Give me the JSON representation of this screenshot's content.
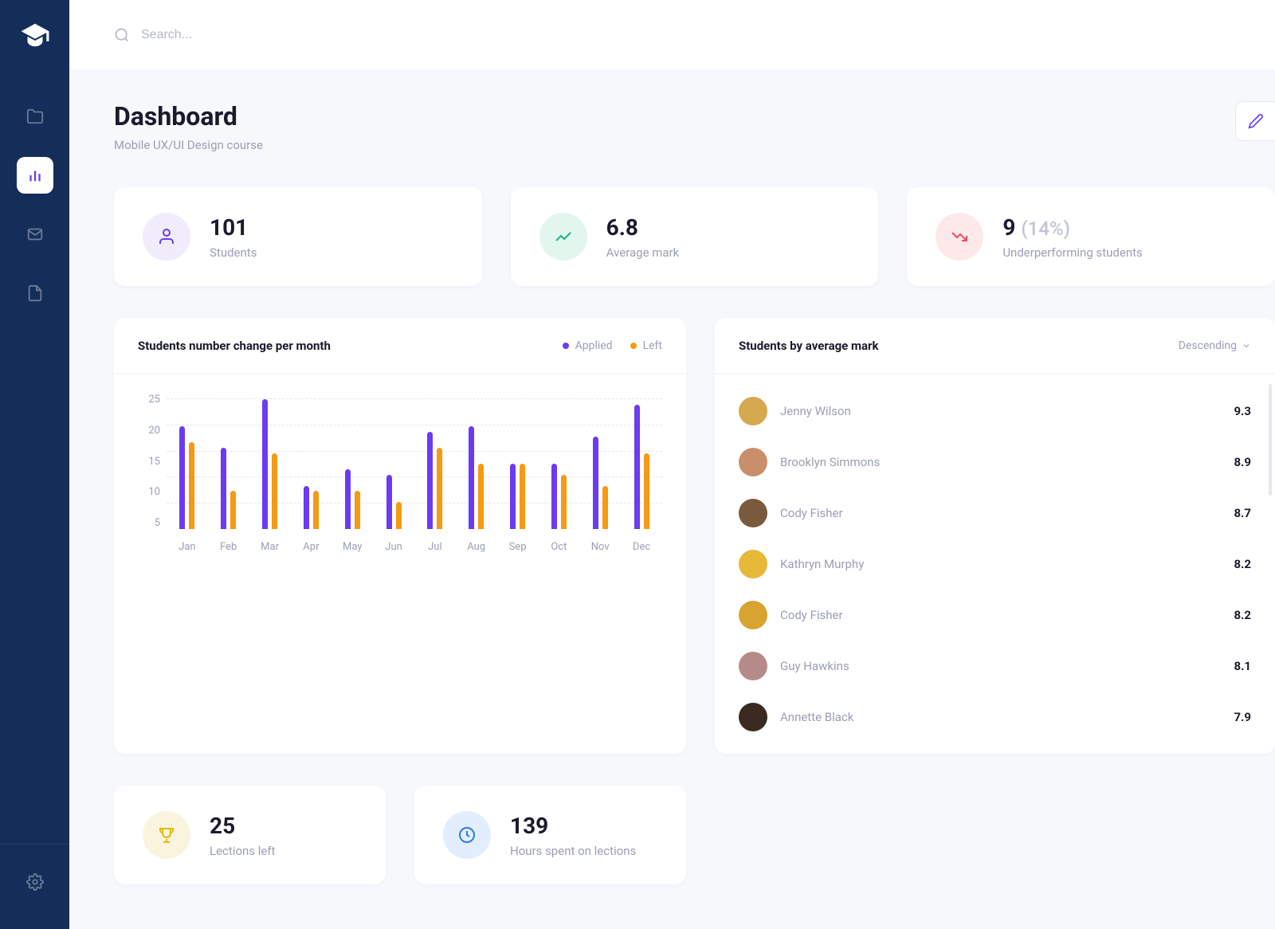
{
  "search": {
    "placeholder": "Search..."
  },
  "page": {
    "title": "Dashboard",
    "subtitle": "Mobile UX/UI Design course"
  },
  "stats": {
    "students": {
      "value": "101",
      "label": "Students"
    },
    "avg_mark": {
      "value": "6.8",
      "label": "Average mark"
    },
    "underperf": {
      "value": "9",
      "pct": "(14%)",
      "label": "Underperforming students"
    }
  },
  "chart_panel": {
    "title": "Students number change per month",
    "legend_applied": "Applied",
    "legend_left": "Left"
  },
  "chart_data": {
    "type": "bar",
    "categories": [
      "Jan",
      "Feb",
      "Mar",
      "Apr",
      "May",
      "Jun",
      "Jul",
      "Aug",
      "Sep",
      "Oct",
      "Nov",
      "Dec"
    ],
    "series": [
      {
        "name": "Applied",
        "values": [
          19,
          15,
          24,
          8,
          11,
          10,
          18,
          19,
          12,
          12,
          17,
          23
        ]
      },
      {
        "name": "Left",
        "values": [
          16,
          7,
          14,
          7,
          7,
          5,
          15,
          12,
          12,
          10,
          8,
          14
        ]
      }
    ],
    "ylabel": "",
    "xlabel": "",
    "ylim": [
      0,
      25
    ],
    "y_ticks": [
      25,
      20,
      15,
      10,
      5
    ]
  },
  "students_panel": {
    "title": "Students by average mark",
    "sort_label": "Descending",
    "avatar_colors": [
      "#d4a94f",
      "#c98f6a",
      "#7a5a3c",
      "#e8b838",
      "#d8a430",
      "#b78a8a",
      "#3a2a22"
    ],
    "list": [
      {
        "name": "Jenny Wilson",
        "mark": "9.3"
      },
      {
        "name": "Brooklyn Simmons",
        "mark": "8.9"
      },
      {
        "name": "Cody Fisher",
        "mark": "8.7"
      },
      {
        "name": "Kathryn Murphy",
        "mark": "8.2"
      },
      {
        "name": "Cody Fisher",
        "mark": "8.2"
      },
      {
        "name": "Guy Hawkins",
        "mark": "8.1"
      },
      {
        "name": "Annette Black",
        "mark": "7.9"
      }
    ]
  },
  "stats2": {
    "lections_left": {
      "value": "25",
      "label": "Lections left"
    },
    "hours_spent": {
      "value": "139",
      "label": "Hours spent on lections"
    }
  },
  "colors": {
    "applied": "#6b3bf2",
    "left": "#f59a12"
  }
}
